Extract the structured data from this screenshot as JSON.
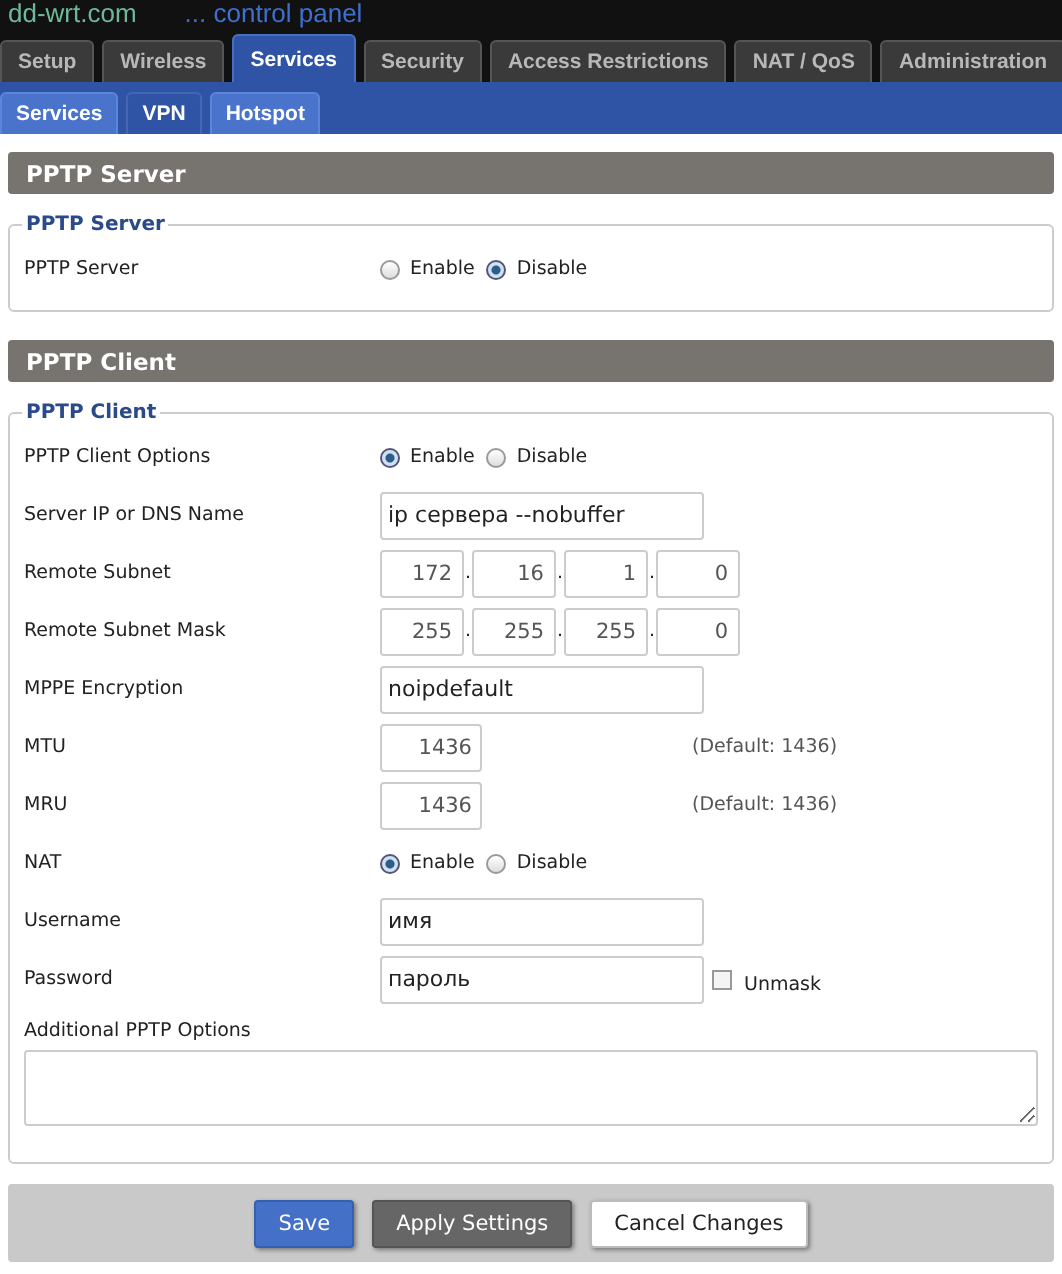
{
  "logo": {
    "name": "dd-wrt.com",
    "tagline": "... control panel"
  },
  "main_tabs": [
    {
      "label": "Setup",
      "selected": false
    },
    {
      "label": "Wireless",
      "selected": false
    },
    {
      "label": "Services",
      "selected": true
    },
    {
      "label": "Security",
      "selected": false
    },
    {
      "label": "Access Restrictions",
      "selected": false
    },
    {
      "label": "NAT / QoS",
      "selected": false
    },
    {
      "label": "Administration",
      "selected": false
    }
  ],
  "sub_tabs": [
    {
      "label": "Services",
      "selected": false
    },
    {
      "label": "VPN",
      "selected": true
    },
    {
      "label": "Hotspot",
      "selected": false
    }
  ],
  "sections": [
    {
      "title": "PPTP Server",
      "legend": "PPTP Server",
      "fields": [
        {
          "kind": "radio",
          "label": "PPTP Server",
          "options": [
            {
              "label": "Enable",
              "selected": false
            },
            {
              "label": "Disable",
              "selected": true
            }
          ]
        }
      ]
    },
    {
      "title": "PPTP Client",
      "legend": "PPTP Client",
      "fields": [
        {
          "kind": "radio",
          "label": "PPTP Client Options",
          "options": [
            {
              "label": "Enable",
              "selected": true
            },
            {
              "label": "Disable",
              "selected": false
            }
          ]
        },
        {
          "kind": "text",
          "label": "Server IP or DNS Name",
          "value": "ip сервера --nobuffer"
        },
        {
          "kind": "ip",
          "label": "Remote Subnet",
          "separator": ".",
          "octets": [
            "172",
            "16",
            "1",
            "0"
          ]
        },
        {
          "kind": "ip",
          "label": "Remote Subnet Mask",
          "separator": ".",
          "octets": [
            "255",
            "255",
            "255",
            "0"
          ]
        },
        {
          "kind": "text",
          "label": "MPPE Encryption",
          "value": "noipdefault"
        },
        {
          "kind": "number",
          "label": "MTU",
          "value": "1436",
          "note": "(Default: 1436)"
        },
        {
          "kind": "number",
          "label": "MRU",
          "value": "1436",
          "note": "(Default: 1436)"
        },
        {
          "kind": "radio",
          "label": "NAT",
          "options": [
            {
              "label": "Enable",
              "selected": true
            },
            {
              "label": "Disable",
              "selected": false
            }
          ]
        },
        {
          "kind": "text",
          "label": "Username",
          "value": "имя"
        },
        {
          "kind": "password",
          "label": "Password",
          "value": "пароль",
          "unmask": {
            "label": "Unmask",
            "checked": false
          }
        },
        {
          "kind": "textarea",
          "label": "Additional PPTP Options"
        }
      ]
    }
  ],
  "buttons": [
    {
      "label": "Save",
      "kind": "primary"
    },
    {
      "label": "Apply Settings",
      "kind": "dark"
    },
    {
      "label": "Cancel Changes",
      "kind": "plain"
    }
  ]
}
